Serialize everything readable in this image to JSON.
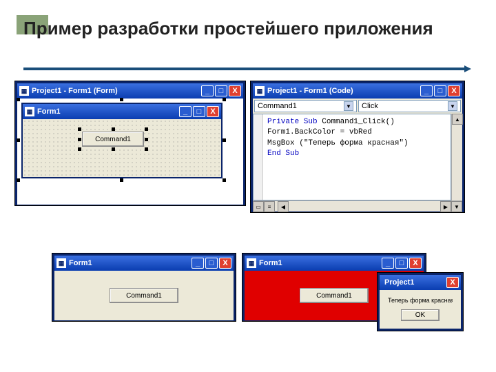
{
  "slide": {
    "title": "Пример разработки простейшего приложения"
  },
  "designerOuter": {
    "title": "Project1 - Form1 (Form)"
  },
  "designerInner": {
    "title": "Form1",
    "button": "Command1"
  },
  "codeWin": {
    "title": "Project1 - Form1 (Code)",
    "objectDropdown": "Command1",
    "eventDropdown": "Click",
    "code": {
      "l1a": "Private Sub",
      "l1b": " Command1_Click()",
      "l2": "Form1.BackColor = vbRed",
      "l3a": "MsgBox (",
      "l3b": "\"Теперь форма красная\"",
      "l3c": ")",
      "l4": "End Sub"
    }
  },
  "runBefore": {
    "title": "Form1",
    "button": "Command1"
  },
  "runAfter": {
    "title": "Form1",
    "button": "Command1"
  },
  "msgbox": {
    "title": "Project1",
    "text": "Теперь форма красная",
    "ok": "OK"
  },
  "glyphs": {
    "min": "_",
    "max": "□",
    "close": "X",
    "down": "▼",
    "left": "◀",
    "right": "▶",
    "up": "▲"
  }
}
